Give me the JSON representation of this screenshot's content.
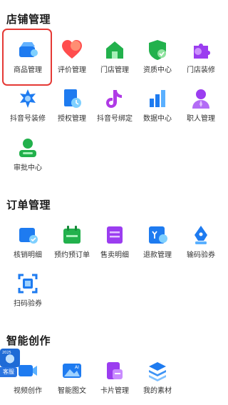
{
  "sections": [
    {
      "title": "店铺管理",
      "items": [
        {
          "label": "商品管理",
          "icon": "product-box-icon"
        },
        {
          "label": "评价管理",
          "icon": "heart-icon"
        },
        {
          "label": "门店管理",
          "icon": "store-house-icon"
        },
        {
          "label": "资质中心",
          "icon": "shield-check-icon"
        },
        {
          "label": "门店装修",
          "icon": "puzzle-icon"
        },
        {
          "label": "抖音号装修",
          "icon": "flower-gear-icon"
        },
        {
          "label": "授权管理",
          "icon": "auth-doc-icon"
        },
        {
          "label": "抖音号绑定",
          "icon": "douyin-note-icon"
        },
        {
          "label": "数据中心",
          "icon": "bar-chart-icon"
        },
        {
          "label": "职人管理",
          "icon": "person-tie-icon"
        },
        {
          "label": "审批中心",
          "icon": "approver-user-icon"
        }
      ]
    },
    {
      "title": "订单管理",
      "items": [
        {
          "label": "核销明细",
          "icon": "verify-card-icon"
        },
        {
          "label": "预约预订单",
          "icon": "calendar-icon"
        },
        {
          "label": "售卖明细",
          "icon": "sales-list-icon"
        },
        {
          "label": "退款管理",
          "icon": "refund-icon"
        },
        {
          "label": "输码验券",
          "icon": "pen-nib-icon"
        },
        {
          "label": "扫码验券",
          "icon": "scan-code-icon"
        }
      ]
    },
    {
      "title": "智能创作",
      "items": [
        {
          "label": "视频创作",
          "icon": "video-camera-icon"
        },
        {
          "label": "智能图文",
          "icon": "ai-image-icon"
        },
        {
          "label": "卡片管理",
          "icon": "card-stack-icon"
        },
        {
          "label": "我的素材",
          "icon": "layers-icon"
        }
      ]
    }
  ],
  "floating": {
    "service_label": "客服",
    "avatar_text": "2025"
  },
  "colors": {
    "highlight": "#e53935",
    "accent_blue": "#1e7bf0"
  }
}
